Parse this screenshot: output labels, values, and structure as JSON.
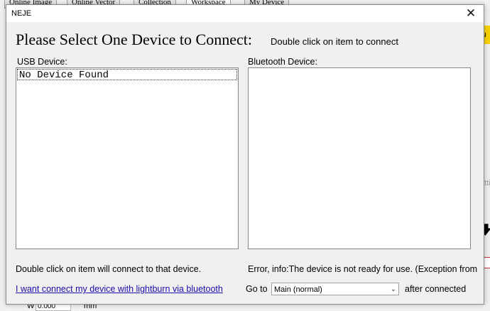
{
  "background": {
    "tabs": [
      "Online Image",
      "Online Vector",
      "Collection",
      "Workspace",
      "My Device"
    ],
    "right_tab_text": "Ou",
    "right_text": "etti",
    "bottom_w_label": "W",
    "bottom_w_value": "0.000",
    "bottom_unit": "mm"
  },
  "dialog": {
    "title": "NEJE",
    "close_glyph": "✕",
    "heading": "Please Select One Device to Connect:",
    "hint": "Double click on item to connect",
    "usb_label": "USB Device:",
    "usb_items": [
      "No Device Found"
    ],
    "bluetooth_label": "Bluetooth Device:",
    "usb_status": "Double click on item will connect to that device.",
    "bt_status": "Error, info:The device is not ready for use. (Exception from",
    "lightburn_link": "I want connect my device with lightburn via bluetooth",
    "goto_label": "Go to",
    "goto_selected": "Main (normal)",
    "after_label": "after connected"
  },
  "colors": {
    "accent_yellow": "#f4d000",
    "link_blue": "#1a0dab"
  }
}
